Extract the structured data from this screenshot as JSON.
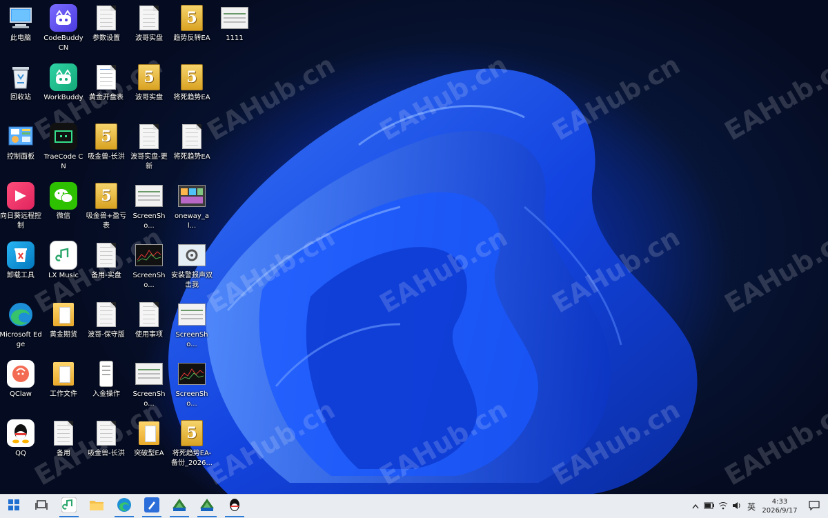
{
  "desktop": {
    "watermark_text": "EAHub.cn",
    "icons": [
      {
        "label": "此电脑",
        "icon": "computer-icon"
      },
      {
        "label": "CodeBuddy CN",
        "icon": "codebuddy-icon"
      },
      {
        "label": "参数设置",
        "icon": "document-icon"
      },
      {
        "label": "波哥实盘",
        "icon": "document-icon"
      },
      {
        "label": "趋势反转EA",
        "icon": "mt5-file-icon"
      },
      {
        "label": "1111",
        "icon": "screenshot-thumbnail-icon"
      },
      {
        "label": "回收站",
        "icon": "recycle-bin-icon"
      },
      {
        "label": "WorkBuddy",
        "icon": "workbuddy-icon"
      },
      {
        "label": "黄金开盘表",
        "icon": "spreadsheet-icon"
      },
      {
        "label": "波哥实盘",
        "icon": "mt5-file-icon"
      },
      {
        "label": "将死趋势EA",
        "icon": "mt5-file-icon"
      },
      {
        "label": "控制面板",
        "icon": "control-panel-icon"
      },
      {
        "label": "TraeCode CN",
        "icon": "traecode-icon"
      },
      {
        "label": "吸金兽-长洪",
        "icon": "mt5-file-icon"
      },
      {
        "label": "波哥实盘-更新",
        "icon": "document-icon"
      },
      {
        "label": "将死趋势EA",
        "icon": "document-icon"
      },
      {
        "label": "向日葵远程控制",
        "icon": "sunlogin-icon"
      },
      {
        "label": "微信",
        "icon": "wechat-icon"
      },
      {
        "label": "吸金兽+盈亏表",
        "icon": "mt5-file-icon"
      },
      {
        "label": "ScreenSho...",
        "icon": "screenshot-thumbnail-icon"
      },
      {
        "label": "oneway_al...",
        "icon": "image-thumbnail-icon"
      },
      {
        "label": "卸载工具",
        "icon": "uninstall-tool-icon"
      },
      {
        "label": "LX Music",
        "icon": "lx-music-icon"
      },
      {
        "label": "备用-实盘",
        "icon": "document-icon"
      },
      {
        "label": "ScreenSho...",
        "icon": "chart-thumbnail-icon"
      },
      {
        "label": "安装警报声双击我",
        "icon": "settings-file-icon"
      },
      {
        "label": "Microsoft Edge",
        "icon": "edge-icon"
      },
      {
        "label": "黄金期货",
        "icon": "folder-icon"
      },
      {
        "label": "波哥-保守版",
        "icon": "document-icon"
      },
      {
        "label": "使用事项",
        "icon": "document-icon"
      },
      {
        "label": "ScreenSho...",
        "icon": "screenshot-thumbnail-icon"
      },
      {
        "label": "QClaw",
        "icon": "qclaw-icon"
      },
      {
        "label": "工作文件",
        "icon": "folder-icon"
      },
      {
        "label": "入金操作",
        "icon": "phone-screenshot-icon"
      },
      {
        "label": "ScreenSho...",
        "icon": "screenshot-thumbnail-icon"
      },
      {
        "label": "ScreenSho...",
        "icon": "chart-thumbnail-icon"
      },
      {
        "label": "QQ",
        "icon": "qq-icon"
      },
      {
        "label": "备用",
        "icon": "document-icon"
      },
      {
        "label": "吸金兽-长洪",
        "icon": "document-icon"
      },
      {
        "label": "突破型EA",
        "icon": "folder-icon"
      },
      {
        "label": "将死趋势EA-备份_2026...",
        "icon": "mt5-file-icon"
      }
    ]
  },
  "taskbar": {
    "apps": [
      {
        "name": "start-button",
        "icon": "windows-icon"
      },
      {
        "name": "task-view-button",
        "icon": "task-view-icon"
      },
      {
        "name": "lx-music-taskbar",
        "icon": "lx-music-icon"
      },
      {
        "name": "file-explorer-taskbar",
        "icon": "folder-icon"
      },
      {
        "name": "edge-taskbar",
        "icon": "edge-icon"
      },
      {
        "name": "app-blue-taskbar",
        "icon": "pen-app-icon"
      },
      {
        "name": "mt5-taskbar-1",
        "icon": "mt5-icon"
      },
      {
        "name": "mt5-taskbar-2",
        "icon": "mt5-icon"
      },
      {
        "name": "qq-taskbar",
        "icon": "qq-icon"
      }
    ],
    "tray": {
      "language": "英",
      "time": "4:33",
      "date": "2026/9/17"
    }
  }
}
